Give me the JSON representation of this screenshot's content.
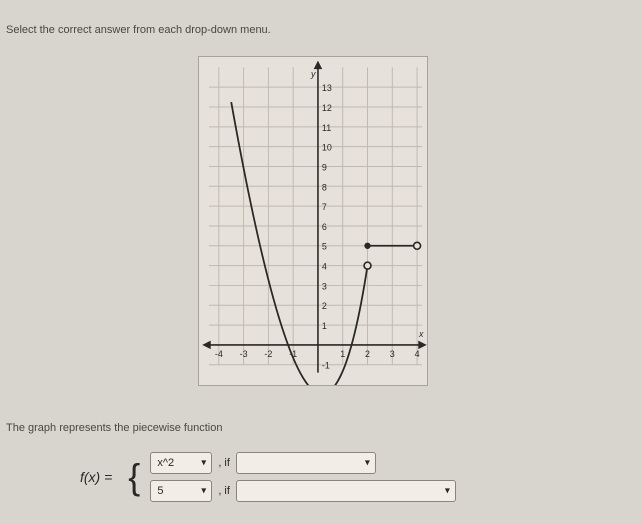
{
  "instruction": "Select the correct answer from each drop-down menu.",
  "statement": "The graph represents the piecewise function",
  "function_label": "f(x) =",
  "rows": {
    "r1": {
      "piece": "x^2",
      "sep": ", if",
      "cond": ""
    },
    "r2": {
      "piece": "5",
      "sep": ", if",
      "cond": ""
    }
  },
  "chart_data": {
    "type": "line",
    "title": "",
    "xlabel": "x",
    "ylabel": "y",
    "xlim": [
      -4,
      4
    ],
    "ylim": [
      -1,
      13
    ],
    "xticks": [
      -4,
      -3,
      -2,
      -1,
      1,
      2,
      3,
      4
    ],
    "yticks": [
      -1,
      1,
      2,
      3,
      4,
      5,
      6,
      7,
      8,
      9,
      10,
      11,
      12,
      13
    ],
    "series": [
      {
        "name": "f(x)=x^2",
        "domain": "-3 ≤ x ≤ 2",
        "points": [
          {
            "x": -3,
            "y": 9
          },
          {
            "x": -2.5,
            "y": 6.25
          },
          {
            "x": -2,
            "y": 4
          },
          {
            "x": -1.5,
            "y": 2.25
          },
          {
            "x": -1,
            "y": 1
          },
          {
            "x": -0.5,
            "y": 0.25
          },
          {
            "x": 0,
            "y": 0
          },
          {
            "x": 0.5,
            "y": 0.25
          },
          {
            "x": 1,
            "y": 1
          },
          {
            "x": 1.5,
            "y": 2.25
          },
          {
            "x": 2,
            "y": 4
          }
        ],
        "endpoints": {
          "right": {
            "x": 2,
            "y": 4,
            "open": true
          }
        }
      },
      {
        "name": "f(x)=5",
        "domain": "2 ≤ x ≤ 4",
        "points": [
          {
            "x": 2,
            "y": 5
          },
          {
            "x": 4,
            "y": 5
          }
        ],
        "endpoints": {
          "right": {
            "x": 4,
            "y": 5,
            "open": true
          }
        }
      }
    ]
  }
}
